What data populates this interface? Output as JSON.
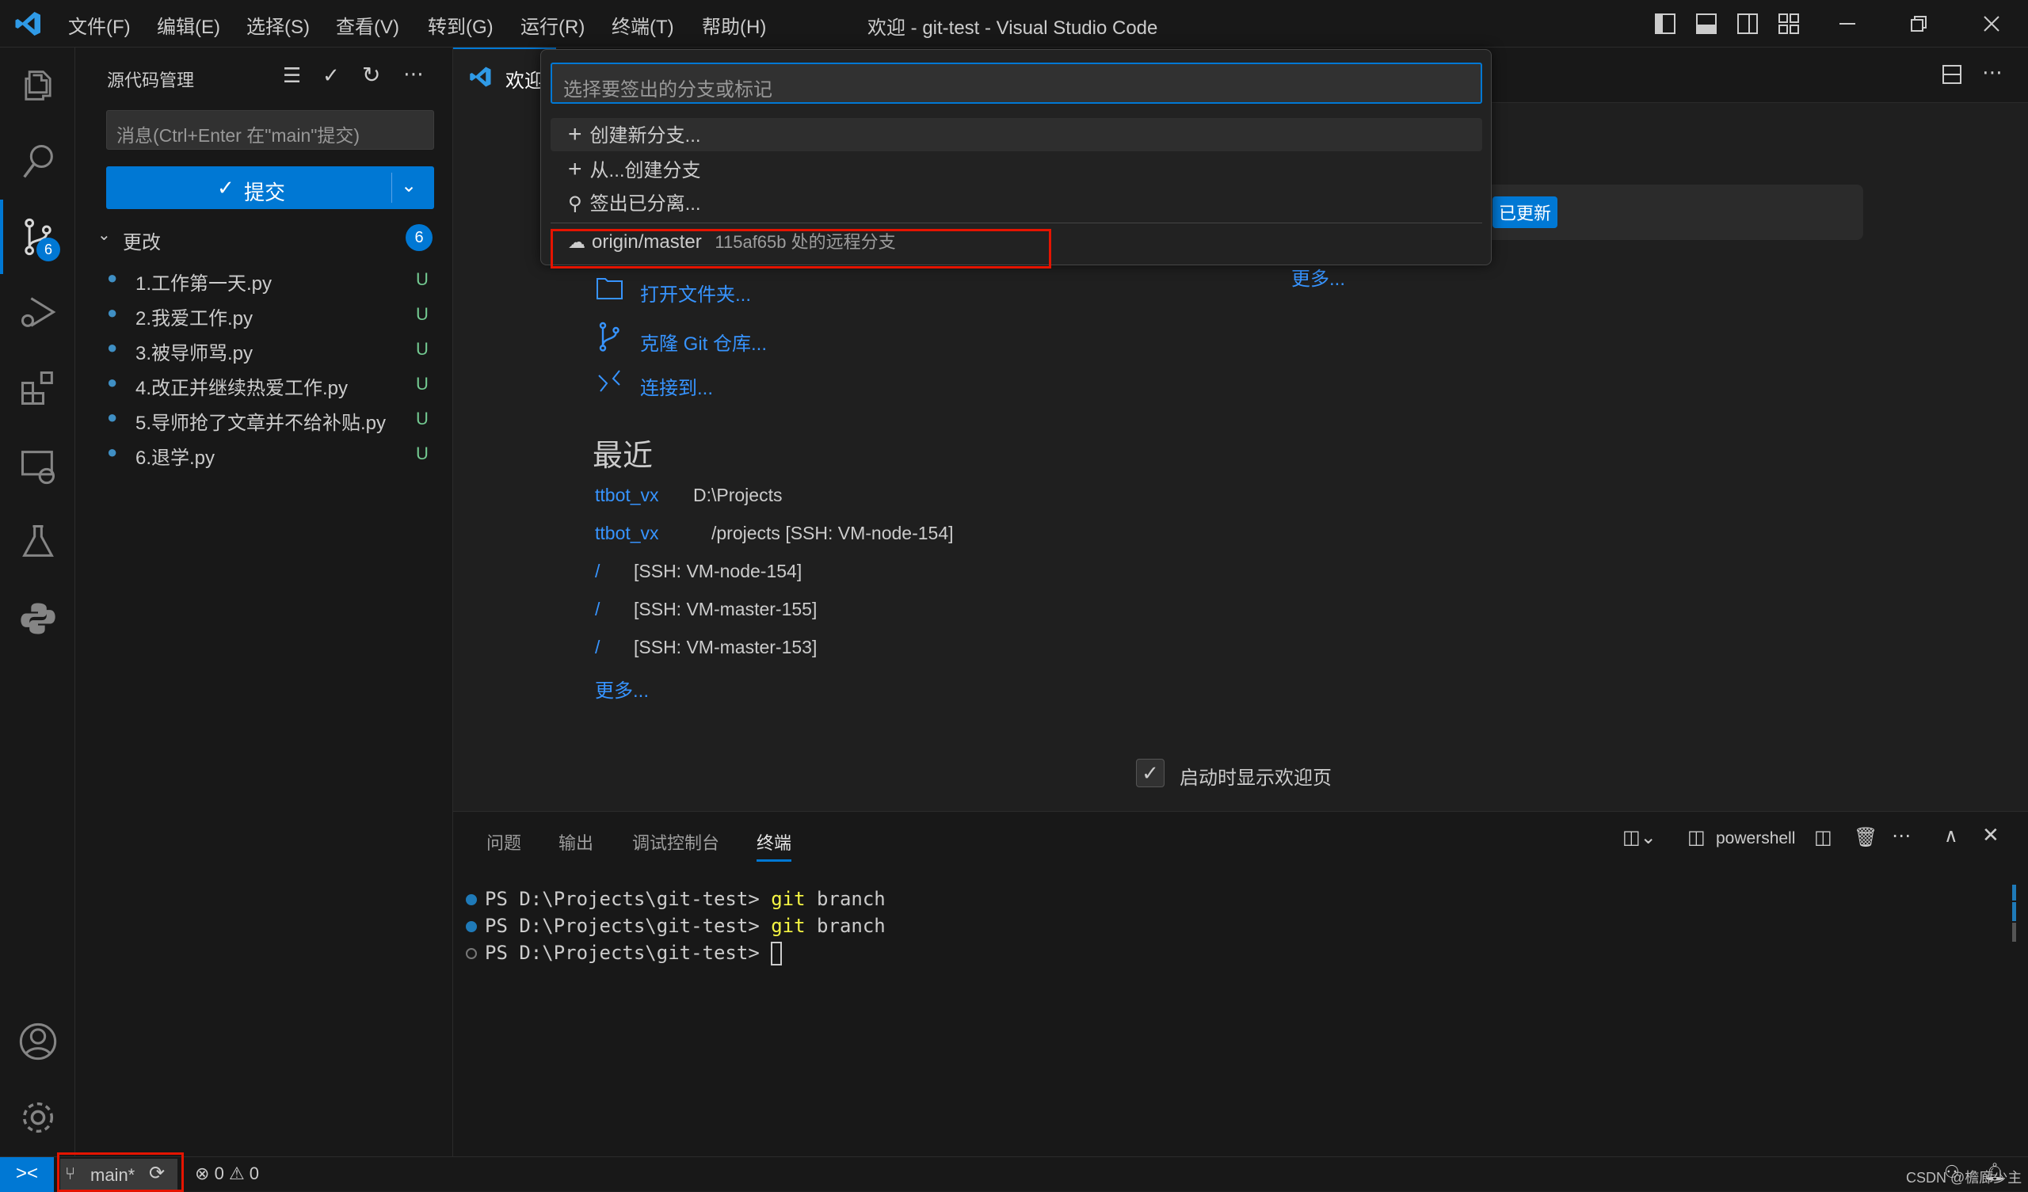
{
  "window": {
    "title": "欢迎 - git-test - Visual Studio Code",
    "menu": [
      "文件(F)",
      "编辑(E)",
      "选择(S)",
      "查看(V)",
      "转到(G)",
      "运行(R)",
      "终端(T)",
      "帮助(H)"
    ]
  },
  "activity_bar": {
    "scm_badge": "6",
    "items": [
      "explorer-icon",
      "search-icon",
      "source-control-icon",
      "run-debug-icon",
      "extensions-icon",
      "remote-explorer-icon",
      "testing-icon",
      "python-icon"
    ],
    "bottom": [
      "account-icon",
      "settings-gear-icon"
    ]
  },
  "sidebar": {
    "title": "源代码管理",
    "message_placeholder": "消息(Ctrl+Enter 在\"main\"提交)",
    "commit_label": "提交",
    "changes_label": "更改",
    "changes_count": "6",
    "files": [
      {
        "name": "1.工作第一天.py",
        "status": "U"
      },
      {
        "name": "2.我爱工作.py",
        "status": "U"
      },
      {
        "name": "3.被导师骂.py",
        "status": "U"
      },
      {
        "name": "4.改正并继续热爱工作.py",
        "status": "U"
      },
      {
        "name": "5.导师抢了文章并不给补贴.py",
        "status": "U"
      },
      {
        "name": "6.退学.py",
        "status": "U"
      }
    ]
  },
  "editor": {
    "tab_label": "欢迎"
  },
  "quick_pick": {
    "placeholder": "选择要签出的分支或标记",
    "items": [
      {
        "label": "创建新分支...",
        "icon": "plus-icon"
      },
      {
        "label": "从...创建分支",
        "icon": "plus-icon"
      },
      {
        "label": "签出已分离...",
        "icon": "debug-disconnect-icon"
      }
    ],
    "branch": {
      "name": "origin/master",
      "description": "115af65b 处的远程分支",
      "icon": "cloud-icon"
    }
  },
  "welcome": {
    "updated_badge": "已更新",
    "more_top": "更多...",
    "start": [
      {
        "label": "打开文件夹...",
        "icon": "folder-icon"
      },
      {
        "label": "克隆 Git 仓库...",
        "icon": "git-branch-icon"
      },
      {
        "label": "连接到...",
        "icon": "remote-icon"
      }
    ],
    "recent_title": "最近",
    "recent": [
      {
        "name": "ttbot_vx",
        "path": "D:\\Projects"
      },
      {
        "name": "ttbot_vx",
        "path": "/projects [SSH: VM-node-154]"
      },
      {
        "name": "/",
        "path": "[SSH: VM-node-154]"
      },
      {
        "name": "/",
        "path": "[SSH: VM-master-155]"
      },
      {
        "name": "/",
        "path": "[SSH: VM-master-153]"
      }
    ],
    "recent_more": "更多...",
    "show_on_startup": "启动时显示欢迎页",
    "show_on_startup_checked": true
  },
  "panel": {
    "tabs": [
      "问题",
      "输出",
      "调试控制台",
      "终端"
    ],
    "active_tab": "终端",
    "shell": "powershell",
    "terminal": [
      {
        "prompt": "PS D:\\Projects\\git-test> ",
        "cmd": "git",
        "arg": " branch"
      },
      {
        "prompt": "PS D:\\Projects\\git-test> ",
        "cmd": "git",
        "arg": " branch"
      },
      {
        "prompt": "PS D:\\Projects\\git-test> ",
        "cmd": "",
        "arg": ""
      }
    ]
  },
  "status_bar": {
    "branch": "main*",
    "errors": "0",
    "warnings": "0",
    "watermark": "CSDN @檐廊少主"
  },
  "colors": {
    "accent": "#0078d4",
    "link": "#3794ff",
    "highlight_box": "#e51400"
  }
}
